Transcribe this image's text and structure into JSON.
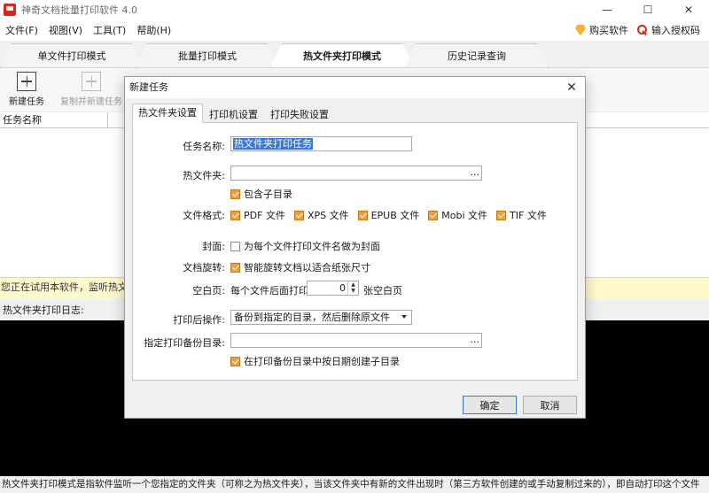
{
  "app": {
    "title": "神奇文档批量打印软件 4.0"
  },
  "window_controls": {
    "minimize": "—",
    "maximize": "☐",
    "close": "✕"
  },
  "menu": {
    "items": [
      "文件(F)",
      "视图(V)",
      "工具(T)",
      "帮助(H)"
    ],
    "buy": "购买软件",
    "license": "输入授权码"
  },
  "mode_tabs": [
    {
      "label": "单文件打印模式",
      "active": false
    },
    {
      "label": "批量打印模式",
      "active": false
    },
    {
      "label": "热文件夹打印模式",
      "active": true
    },
    {
      "label": "历史记录查询",
      "active": false
    }
  ],
  "toolbar": {
    "new_task": "新建任务",
    "copy_new_task": "复制并新建任务"
  },
  "task_list": {
    "column_name": "任务名称"
  },
  "trial_notice": "您正在试用本软件，监听热文件夹",
  "log": {
    "header": "热文件夹打印日志:"
  },
  "status_bar": "热文件夹打印模式是指软件监听一个您指定的文件夹（可称之为热文件夹），当该文件夹中有新的文件出现时（第三方软件创建的或手动复制过来的），即自动打印这个文件",
  "dialog": {
    "title": "新建任务",
    "close": "✕",
    "tabs": [
      {
        "label": "热文件夹设置",
        "active": true
      },
      {
        "label": "打印机设置",
        "active": false
      },
      {
        "label": "打印失败设置",
        "active": false
      }
    ],
    "task_name_label": "任务名称:",
    "task_name_value": "热文件夹打印任务",
    "hot_folder_label": "热文件夹:",
    "hot_folder_value": "",
    "browse": "...",
    "include_subdirs": "包含子目录",
    "file_format_label": "文件格式:",
    "formats": [
      "PDF 文件",
      "XPS 文件",
      "EPUB 文件",
      "Mobi 文件",
      "TIF 文件"
    ],
    "cover_label": "封面:",
    "cover_option": "为每个文件打印文件名做为封面",
    "rotate_label": "文档旋转:",
    "rotate_option": "智能旋转文档以适合纸张尺寸",
    "blank_label": "空白页:",
    "blank_prefix": "每个文件后面打印",
    "blank_value": "0",
    "blank_suffix": "张空白页",
    "after_print_label": "打印后操作:",
    "after_print_value": "备份到指定的目录，然后删除原文件",
    "backup_dir_label": "指定打印备份目录:",
    "backup_dir_value": "",
    "date_subdir": "在打印备份目录中按日期创建子目录",
    "ok": "确定",
    "cancel": "取消"
  }
}
